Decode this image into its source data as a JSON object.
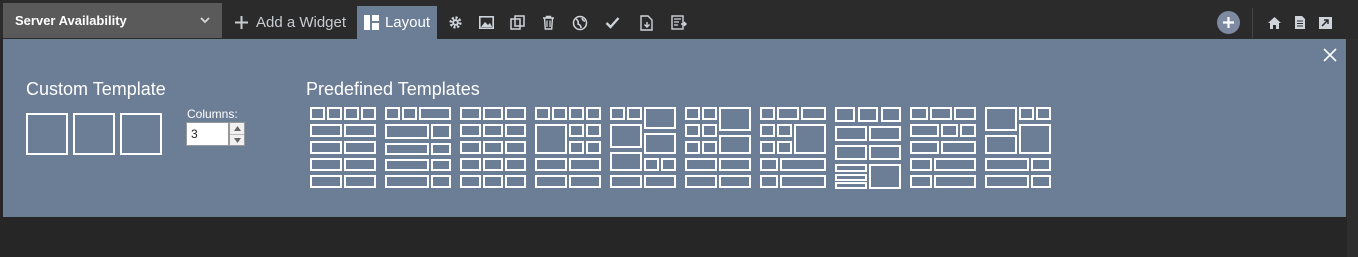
{
  "toolbar": {
    "dashboard_name": "Server Availability",
    "add_widget_label": "Add a Widget",
    "layout_tab_label": "Layout",
    "icons": [
      "gear-icon",
      "image-icon",
      "copy-icon",
      "trash-icon",
      "globe-icon",
      "check-icon",
      "export-file-icon",
      "report-icon"
    ],
    "right_icons": [
      "plus-circle-icon",
      "home-icon",
      "document-icon",
      "screen-icon"
    ]
  },
  "panel": {
    "custom_title": "Custom Template",
    "columns_label": "Columns:",
    "columns_value": "3",
    "predefined_title": "Predefined Templates",
    "template_count": 10
  },
  "colors": {
    "panel_bg": "#6c7d96",
    "toolbar_bg": "#2b2b2b",
    "page_bg": "#262626",
    "accent": "#6c7d96"
  }
}
